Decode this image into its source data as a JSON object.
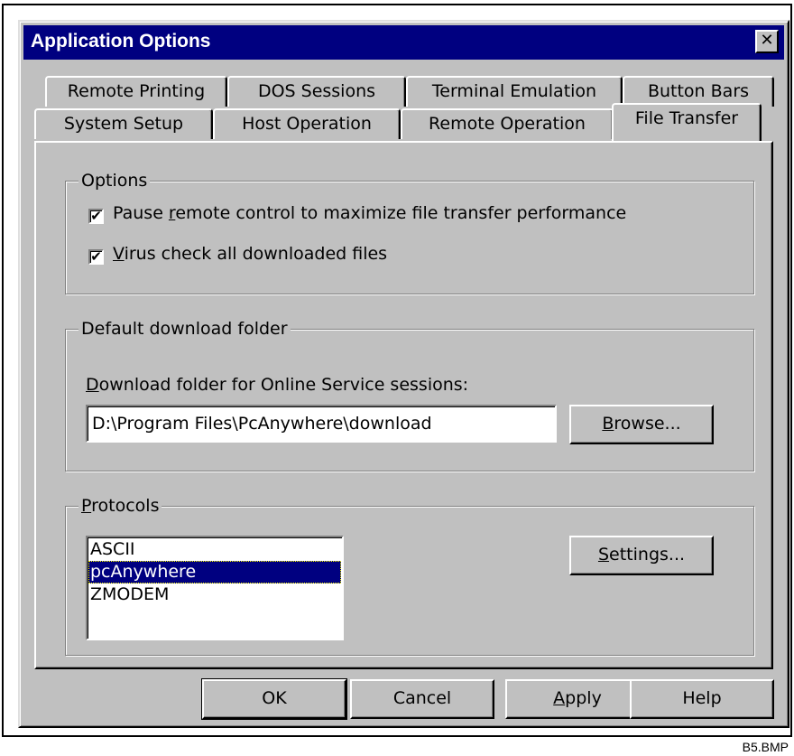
{
  "window": {
    "title": "Application Options",
    "close_glyph": "✕"
  },
  "tabs": {
    "row_back": [
      "Remote Printing",
      "DOS Sessions",
      "Terminal Emulation",
      "Button Bars"
    ],
    "row_front": [
      "System Setup",
      "Host Operation",
      "Remote Operation",
      "File Transfer"
    ],
    "active": "File Transfer"
  },
  "options_group": {
    "title": "Options",
    "pause": {
      "label_pre": "Pause ",
      "label_u": "r",
      "label_post": "emote control to maximize file transfer performance",
      "checked": true,
      "mark": "✔"
    },
    "virus": {
      "label_pre": "",
      "label_u": "V",
      "label_post": "irus check all downloaded files",
      "checked": true,
      "mark": "✔"
    }
  },
  "download_group": {
    "title": "Default download folder",
    "field_label_u": "D",
    "field_label_post": "ownload folder for Online Service sessions:",
    "folder_value": "D:\\Program Files\\PcAnywhere\\download",
    "browse_u": "B",
    "browse_post": "rowse..."
  },
  "protocols_group": {
    "title_u": "P",
    "title_post": "rotocols",
    "items": [
      "ASCII",
      "pcAnywhere",
      "ZMODEM"
    ],
    "selected": "pcAnywhere",
    "settings_u": "S",
    "settings_post": "ettings..."
  },
  "buttons": {
    "ok": "OK",
    "cancel": "Cancel",
    "apply_u": "A",
    "apply_post": "pply",
    "help": "Help"
  },
  "caption": "B5.BMP"
}
